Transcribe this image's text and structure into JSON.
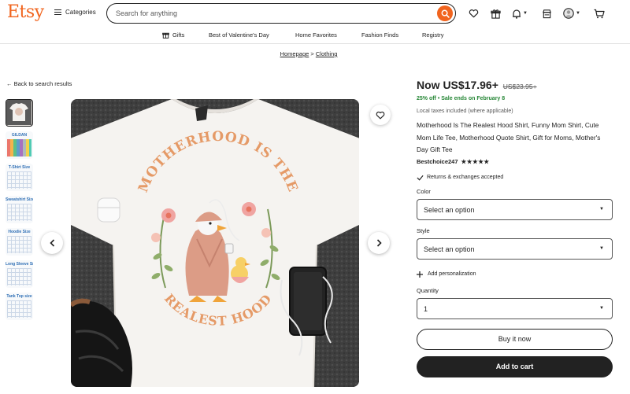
{
  "header": {
    "logo": "Etsy",
    "categories_label": "Categories",
    "search_placeholder": "Search for anything"
  },
  "nav": [
    "Gifts",
    "Best of Valentine's Day",
    "Home Favorites",
    "Fashion Finds",
    "Registry"
  ],
  "breadcrumb": {
    "home": "Homepage",
    "sep": ">",
    "current": "Clothing"
  },
  "back_link": "Back to search results",
  "thumbnails": [
    {
      "kind": "photo",
      "label": ""
    },
    {
      "kind": "swatches",
      "label": "GILDAN"
    },
    {
      "kind": "chart",
      "label": "T-Shirt Size"
    },
    {
      "kind": "chart",
      "label": "Sweatshirt Size"
    },
    {
      "kind": "chart",
      "label": "Hoodie Size"
    },
    {
      "kind": "chart",
      "label": "Long Sleeve Size"
    },
    {
      "kind": "chart",
      "label": "Tank Top size"
    }
  ],
  "shirt": {
    "text_top": "MOTHERHOOD IS THE",
    "text_bottom": "REALEST HOOD"
  },
  "product": {
    "price": "Now US$17.96+",
    "old_price": "US$23.95+",
    "sale": "25% off • Sale ends on February 8",
    "tax": "Local taxes included (where applicable)",
    "title": "Motherhood Is The Realest Hood Shirt, Funny Mom Shirt, Cute Mom Life Tee, Motherhood Quote Shirt, Gift for Moms, Mother's Day Gift Tee",
    "seller": "Bestchoice247",
    "stars": "★★★★★",
    "returns": "Returns & exchanges accepted",
    "color_label": "Color",
    "color_value": "Select an option",
    "style_label": "Style",
    "style_value": "Select an option",
    "personalization": "Add personalization",
    "quantity_label": "Quantity",
    "quantity_value": "1",
    "buy_now": "Buy it now",
    "add_to_cart": "Add to cart"
  },
  "colors": {
    "brand": "#f1641e",
    "sale": "#258635",
    "dark": "#222222"
  }
}
